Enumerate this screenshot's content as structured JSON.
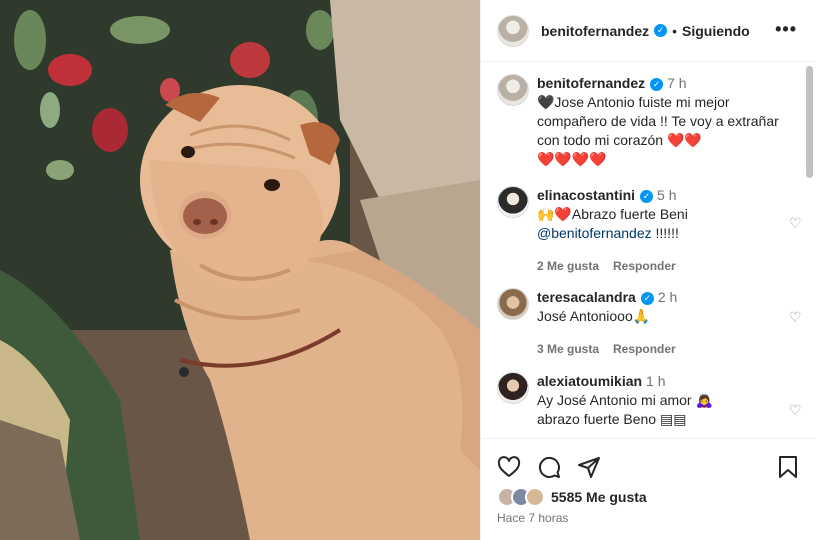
{
  "post": {
    "author": "benitofernandez",
    "follow_status": "Siguiendo",
    "more_label": "•••"
  },
  "caption": {
    "author": "benitofernandez",
    "time": "7 h",
    "text_before": "🖤Jose Antonio fuiste mi mejor compañero de vida !! Te voy a extrañar con todo mi corazón ",
    "hearts": "❤️❤️",
    "hearts_line2": "❤️❤️❤️❤️"
  },
  "comments": [
    {
      "author": "elinacostantini",
      "verified": true,
      "time": "5 h",
      "emoji": "🙌❤️",
      "text": "Abrazo fuerte Beni",
      "mention": "@benitofernandez",
      "tail": " !!!!!!",
      "likes": "2 Me gusta",
      "reply": "Responder"
    },
    {
      "author": "teresacalandra",
      "verified": true,
      "time": "2 h",
      "text": "José Antoniooo🙏",
      "likes": "3 Me gusta",
      "reply": "Responder"
    },
    {
      "author": "alexiatoumikian",
      "verified": false,
      "time": "1 h",
      "text": "Ay José Antonio mi amor 🙇‍♀️",
      "text2": "abrazo fuerte Beno ▤▤"
    }
  ],
  "actions": {
    "likes_count": "5585 Me gusta",
    "posted_ago": "Hace 7 horas"
  },
  "icons": [
    "heart-icon",
    "comment-icon",
    "share-icon",
    "bookmark-icon",
    "verified-icon",
    "more-icon"
  ]
}
